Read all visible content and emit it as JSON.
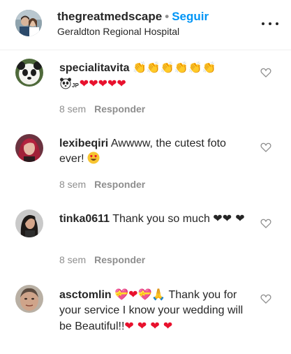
{
  "post": {
    "username": "thegreatmedscape",
    "separator": "•",
    "follow_label": "Seguir",
    "location": "Geraldton Regional Hospital",
    "more_icon": "more-horizontal-icon"
  },
  "comments": [
    {
      "username": "specialitavita",
      "text": "",
      "text_after": "",
      "emoji": [
        "clapping-hands x6",
        "panda",
        "JP",
        "red-heart x5"
      ],
      "time": "8 sem",
      "reply_label": "Responder"
    },
    {
      "username": "lexibeqiri",
      "text": "Awwww, the cutest foto ever!",
      "emoji": [
        "heart-eyes"
      ],
      "time": "8 sem",
      "reply_label": "Responder"
    },
    {
      "username": "tinka0611",
      "text": "Thank you so much",
      "emoji": [
        "black-heart x3"
      ],
      "time": "8 sem",
      "reply_label": "Responder"
    },
    {
      "username": "asctomlin",
      "text": "Thank you for your service I know your wedding will be Beautiful!!",
      "emoji_before": [
        "heart-with-ribbon",
        "red-heart",
        "heart-with-ribbon",
        "folded-hands"
      ],
      "emoji_after": [
        "red-heart x4"
      ]
    }
  ],
  "labels": {
    "jp": "JP"
  },
  "colors": {
    "link_blue": "#0095f6",
    "meta_gray": "#8e8e8e",
    "text": "#262626",
    "heart_red": "#e8112d"
  }
}
